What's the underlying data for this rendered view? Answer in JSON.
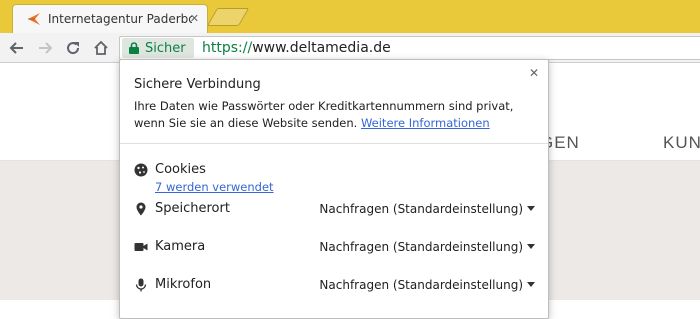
{
  "tab": {
    "title": "Internetagentur Paderborn",
    "close": "✕"
  },
  "toolbar": {
    "secure_label": "Sicher",
    "url_scheme": "https://",
    "url_host": "www.deltamedia.de"
  },
  "background_page": {
    "nav_items": [
      "GEN",
      "KUND"
    ]
  },
  "popup": {
    "title": "Sichere Verbindung",
    "description": "Ihre Daten wie Passwörter oder Kreditkartennummern sind privat, wenn Sie sie an diese Website senden.",
    "more_info_link": "Weitere Informationen",
    "close": "✕",
    "cookies": {
      "label": "Cookies",
      "link": "7 werden verwendet"
    },
    "permissions": [
      {
        "label": "Speicherort",
        "value": "Nachfragen (Standardeinstellung)",
        "icon": "location-icon"
      },
      {
        "label": "Kamera",
        "value": "Nachfragen (Standardeinstellung)",
        "icon": "camera-icon"
      },
      {
        "label": "Mikrofon",
        "value": "Nachfragen (Standardeinstellung)",
        "icon": "microphone-icon"
      }
    ]
  },
  "colors": {
    "tabstrip": "#e9c93a",
    "secure_green": "#0b8043",
    "link_blue": "#3367d6"
  }
}
